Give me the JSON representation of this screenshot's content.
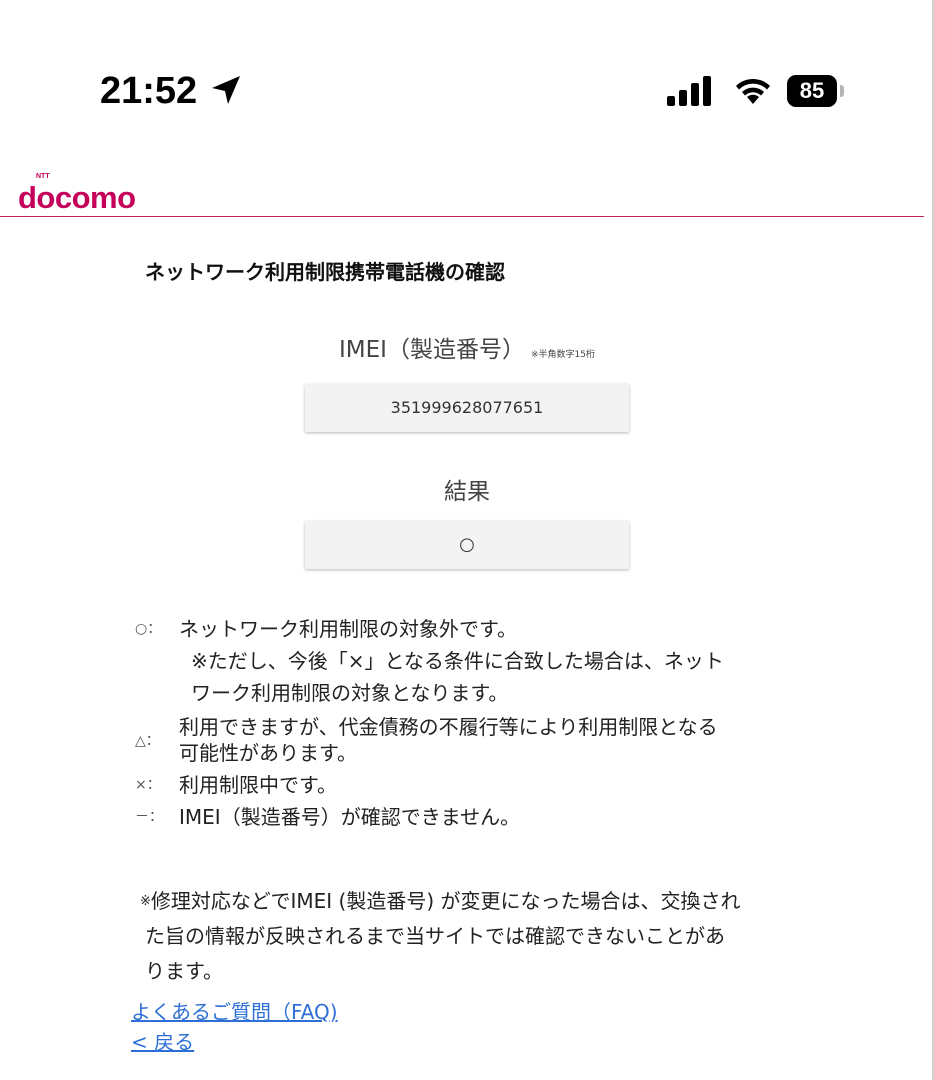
{
  "status_bar": {
    "time": "21:52",
    "battery": "85",
    "icons": [
      "location-arrow-icon",
      "signal-icon",
      "wifi-icon",
      "battery-icon"
    ]
  },
  "header": {
    "brand": "docomo",
    "brand_small": "NTT",
    "accent_color": "#c4005a"
  },
  "page": {
    "title": "ネットワーク利用制限携帯電話機の確認",
    "imei_label": "IMEI（製造番号）",
    "imei_note": "※半角数字15桁",
    "imei_value": "351999628077651",
    "result_label": "結果",
    "result_value": "○"
  },
  "legend": {
    "circle_symbol": "○：",
    "circle_text": "ネットワーク利用制限の対象外です。",
    "circle_sub_1": "※ただし、今後「×」となる条件に合致した場合は、ネット",
    "circle_sub_2": "ワーク利用制限の対象となります。",
    "triangle_symbol": "△：",
    "triangle_text_1": "利用できますが、代金債務の不履行等により利用制限となる",
    "triangle_text_2": "可能性があります。",
    "cross_symbol": "×：",
    "cross_text": "利用制限中です。",
    "dash_symbol": "－：",
    "dash_text": "IMEI（製造番号）が確認できません。"
  },
  "notice": {
    "mark": "※",
    "line_1": "修理対応などでIMEI (製造番号) が変更になった場合は、交換され",
    "line_2": "た旨の情報が反映されるまで当サイトでは確認できないことがあ",
    "line_3": "ります。"
  },
  "links": {
    "faq": "よくあるご質問（FAQ)",
    "back": "< 戻る",
    "color": "#2d6fd6"
  }
}
